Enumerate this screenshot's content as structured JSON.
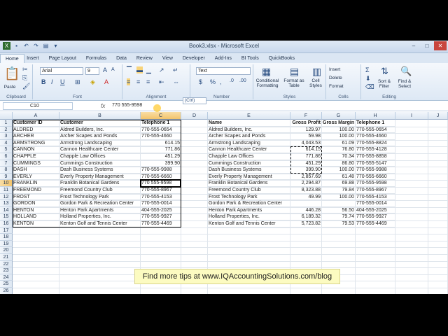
{
  "window": {
    "title": "Book3.xlsx - Microsoft Excel"
  },
  "tabs": [
    "File",
    "Home",
    "Insert",
    "Page Layout",
    "Formulas",
    "Data",
    "Review",
    "View",
    "Developer",
    "Add-Ins",
    "BI Tools",
    "QuickBooks"
  ],
  "ribbon": {
    "clipboard": {
      "label": "Clipboard",
      "paste": "Paste"
    },
    "font": {
      "label": "Font",
      "name": "Arial",
      "size": "9"
    },
    "alignment": {
      "label": "Alignment"
    },
    "number": {
      "label": "Number",
      "format": "Text"
    },
    "styles": {
      "label": "Styles",
      "conditional": "Conditional Formatting",
      "format_table": "Format as Table",
      "cell_styles": "Cell Styles"
    },
    "cells": {
      "label": "Cells",
      "insert": "Insert",
      "delete": "Delete",
      "format": "Format"
    },
    "editing": {
      "label": "Editing",
      "sort": "Sort & Filter",
      "find": "Find & Select"
    }
  },
  "formula_bar": {
    "name_box": "C10",
    "fx": "fx",
    "value": "770 555-9598"
  },
  "columns": [
    "A",
    "B",
    "C",
    "D",
    "E",
    "F",
    "G",
    "H",
    "I",
    "J"
  ],
  "rows": [
    "1",
    "2",
    "3",
    "4",
    "5",
    "6",
    "7",
    "8",
    "9",
    "10",
    "11",
    "12",
    "13",
    "14",
    "15",
    "16",
    "17",
    "18",
    "19",
    "20",
    "21",
    "22",
    "23",
    "24",
    "25",
    "26"
  ],
  "left_table": {
    "headers": [
      "Customer ID",
      "Customer",
      "Telephone 1"
    ],
    "rows": [
      [
        "ALDRED",
        "Aldred Builders, Inc.",
        "770-555-0654"
      ],
      [
        "ARCHER",
        "Archer Scapes and Ponds",
        "770-555-4660"
      ],
      [
        "ARMSTRONG",
        "Armstrong Landscaping",
        "614.15"
      ],
      [
        "CANNON",
        "Cannon Healthcare Center",
        "771.86"
      ],
      [
        "CHAPPLE",
        "Chapple Law Offices",
        "451.29"
      ],
      [
        "CUMMINGS",
        "Cummings Construction",
        "399.90"
      ],
      [
        "DASH",
        "Dash Business Systems",
        "770-555-9988"
      ],
      [
        "EVERLY",
        "Everly Property Management",
        "770-555-6660"
      ],
      [
        "FRANKLIN",
        "Franklin Botanical Gardens",
        "770 555-9598"
      ],
      [
        "FREEMOND",
        "Freemond Country Club",
        "770-555-8967"
      ],
      [
        "FROST",
        "Frost Technology Park",
        "770-555-4153"
      ],
      [
        "GORDON",
        "Gordon Park & Recreation Center",
        "770-555-0014"
      ],
      [
        "HENTON",
        "Henton Park Apartments",
        "404-555-2025"
      ],
      [
        "HOLLAND",
        "Holland Properties, Inc.",
        "770-555-9927"
      ],
      [
        "KENTON",
        "Kenton Golf and Tennis Center",
        "770-555-4469"
      ]
    ]
  },
  "right_table": {
    "headers": [
      "Name",
      "Gross Profit",
      "Gross Margin",
      "Telephone 1"
    ],
    "rows": [
      [
        "Aldred Builders, Inc.",
        "129.97",
        "100.00",
        "770-555-0654"
      ],
      [
        "Archer Scapes and Ponds",
        "59.98",
        "100.00",
        "770-555-4660"
      ],
      [
        "Armstrong Landscaping",
        "4,043.53",
        "61.09",
        "770-555-8824"
      ],
      [
        "Cannon Healthcare Center",
        "614.15",
        "76.80",
        "770-555-4128"
      ],
      [
        "Chapple Law Offices",
        "771.86",
        "70.34",
        "770-555-8858"
      ],
      [
        "Cummings Construction",
        "451.29",
        "86.80",
        "770-555-5147"
      ],
      [
        "Dash Business Systems",
        "399.90",
        "100.00",
        "770-555-9988"
      ],
      [
        "Everly Property Management",
        "2,857.69",
        "61.48",
        "770-555-6660"
      ],
      [
        "Franklin Botanical Gardens",
        "2,294.87",
        "69.88",
        "770-555-9598"
      ],
      [
        "Freemond Country Club",
        "8,323.88",
        "79.84",
        "770-555-8967"
      ],
      [
        "Frost Technology Park",
        "49.99",
        "100.00",
        "770-555-4153"
      ],
      [
        "Gordon Park & Recreation Center",
        "",
        "",
        "770-555-0014"
      ],
      [
        "Henton Park Apartments",
        "446.28",
        "56.50",
        "404-555-2025"
      ],
      [
        "Holland Properties, Inc.",
        "6,189.32",
        "79.74",
        "770-555-9927"
      ],
      [
        "Kenton Golf and Tennis Center",
        "5,723.82",
        "79.53",
        "770-555-4469"
      ]
    ]
  },
  "paste_options": "(Ctrl)",
  "tip": "Find more tips at www.IQAccountingSolutions.com/blog"
}
